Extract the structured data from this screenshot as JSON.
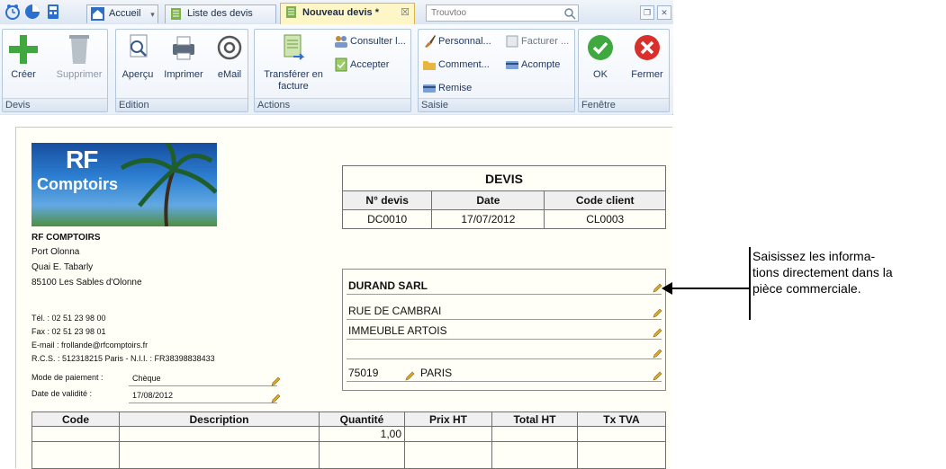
{
  "tabs": {
    "home": "Accueil",
    "list": "Liste des devis",
    "new": "Nouveau devis *"
  },
  "search": {
    "placeholder": "Trouvtoo"
  },
  "ribbon": {
    "devis": {
      "label": "Devis",
      "create": "Créer",
      "delete": "Supprimer"
    },
    "edition": {
      "label": "Edition",
      "preview": "Aperçu",
      "print": "Imprimer",
      "email": "eMail"
    },
    "actions": {
      "label": "Actions",
      "transfer_l1": "Transférer en",
      "transfer_l2": "facture",
      "consult": "Consulter l...",
      "accept": "Accepter"
    },
    "saisie": {
      "label": "Saisie",
      "personal": "Personnal...",
      "invoice": "Facturer ...",
      "comment": "Comment...",
      "deposit": "Acompte",
      "discount": "Remise"
    },
    "fenetre": {
      "label": "Fenêtre",
      "ok": "OK",
      "close": "Fermer"
    }
  },
  "company": {
    "logo_l1": "RF",
    "logo_l2": "Comptoirs",
    "name": "RF COMPTOIRS",
    "addr1": "Port Olonna",
    "addr2": "Quai E. Tabarly",
    "addr3": "85100 Les Sables d'Olonne",
    "tel": "Tél. : 02 51 23 98 00",
    "fax": "Fax : 02 51 23 98 01",
    "email": "E-mail : frollande@rfcomptoirs.fr",
    "rcs": "R.C.S. : 512318215 Paris - N.I.I. : FR38398838433"
  },
  "payment": {
    "label": "Mode de paiement :",
    "value": "Chèque"
  },
  "validity": {
    "label": "Date de validité :",
    "value": "17/08/2012"
  },
  "devis": {
    "title": "DEVIS",
    "h_number": "N° devis",
    "h_date": "Date",
    "h_client": "Code client",
    "number": "DC0010",
    "date": "17/07/2012",
    "client": "CL0003"
  },
  "client": {
    "name": "DURAND SARL",
    "line1": "RUE DE CAMBRAI",
    "line2": "IMMEUBLE ARTOIS",
    "zip": "75019",
    "city": "PARIS"
  },
  "lines": {
    "h_code": "Code",
    "h_desc": "Description",
    "h_qty": "Quantité",
    "h_price": "Prix HT",
    "h_total": "Total HT",
    "h_vat": "Tx TVA",
    "row1_qty": "1,00"
  },
  "callout": {
    "l1": "Saisissez les informa-",
    "l2": "tions directement dans la",
    "l3": "pièce commerciale."
  },
  "colors": {
    "accent": "#d8b64d",
    "ribbon": "#dde6f1",
    "ok": "#3fa83f",
    "close": "#d9302c"
  }
}
